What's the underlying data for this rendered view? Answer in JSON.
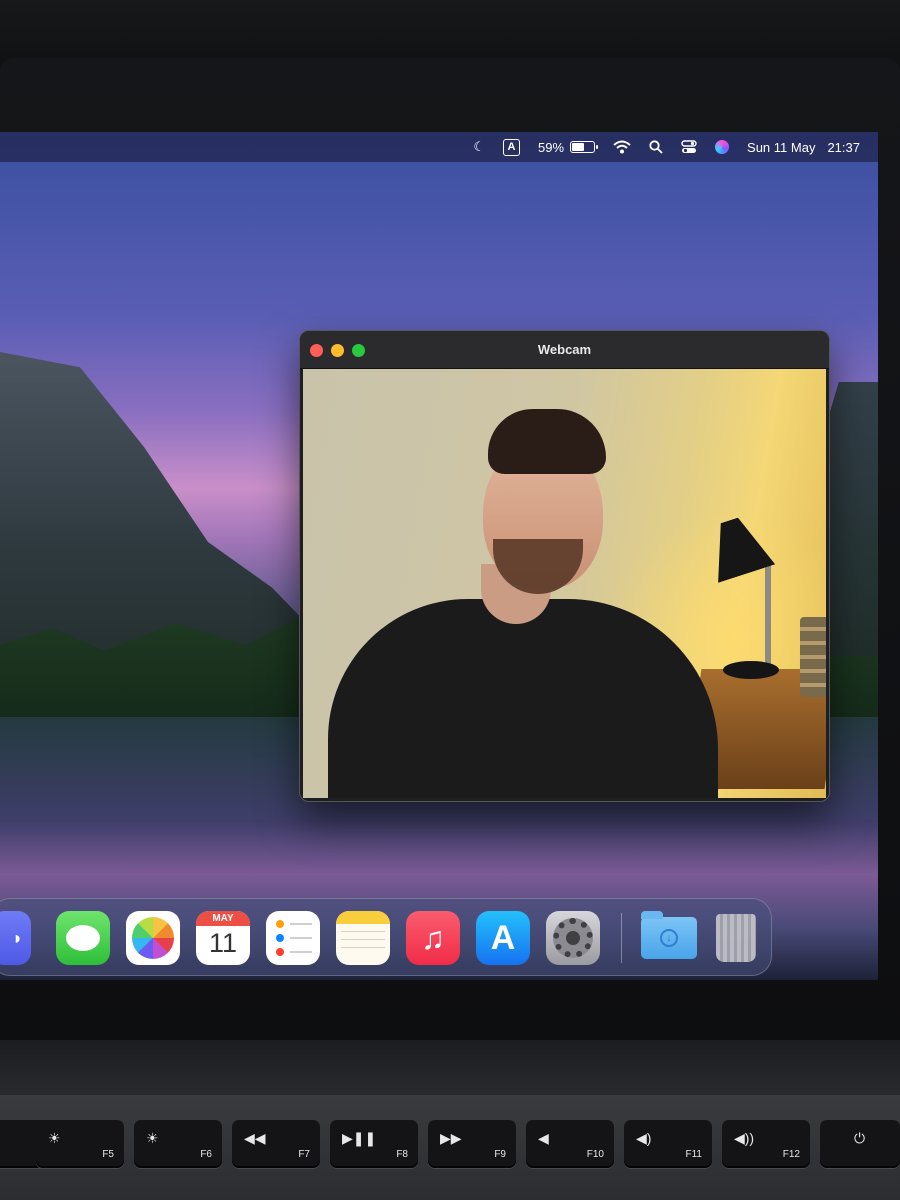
{
  "menubar": {
    "keyboard_input": "A",
    "battery_percent": "59%",
    "battery_level": 0.59,
    "date": "Sun 11 May",
    "time": "21:37",
    "icons": [
      "moon-icon",
      "input-source-icon",
      "battery-icon",
      "wifi-icon",
      "search-icon",
      "control-center-icon",
      "siri-icon"
    ]
  },
  "webcam_window": {
    "title": "Webcam"
  },
  "dock": {
    "apps": [
      {
        "name": "Messages",
        "icon": "messages-icon"
      },
      {
        "name": "Photos",
        "icon": "photos-icon"
      },
      {
        "name": "Calendar",
        "icon": "calendar-icon",
        "month": "MAY",
        "day": "11"
      },
      {
        "name": "Reminders",
        "icon": "reminders-icon"
      },
      {
        "name": "Notes",
        "icon": "notes-icon"
      },
      {
        "name": "Music",
        "icon": "music-icon"
      },
      {
        "name": "App Store",
        "icon": "app-store-icon"
      },
      {
        "name": "System Settings",
        "icon": "settings-icon"
      },
      {
        "name": "Downloads",
        "icon": "downloads-folder-icon"
      },
      {
        "name": "Trash",
        "icon": "trash-icon"
      }
    ]
  },
  "keyboard": {
    "keys": [
      "F5",
      "F6",
      "F7",
      "F8",
      "F9",
      "F10",
      "F11",
      "F12"
    ]
  },
  "colors": {
    "menubar": "#262c5c",
    "close": "#ff5f57",
    "minimize": "#febc2e",
    "zoom": "#28c840"
  }
}
